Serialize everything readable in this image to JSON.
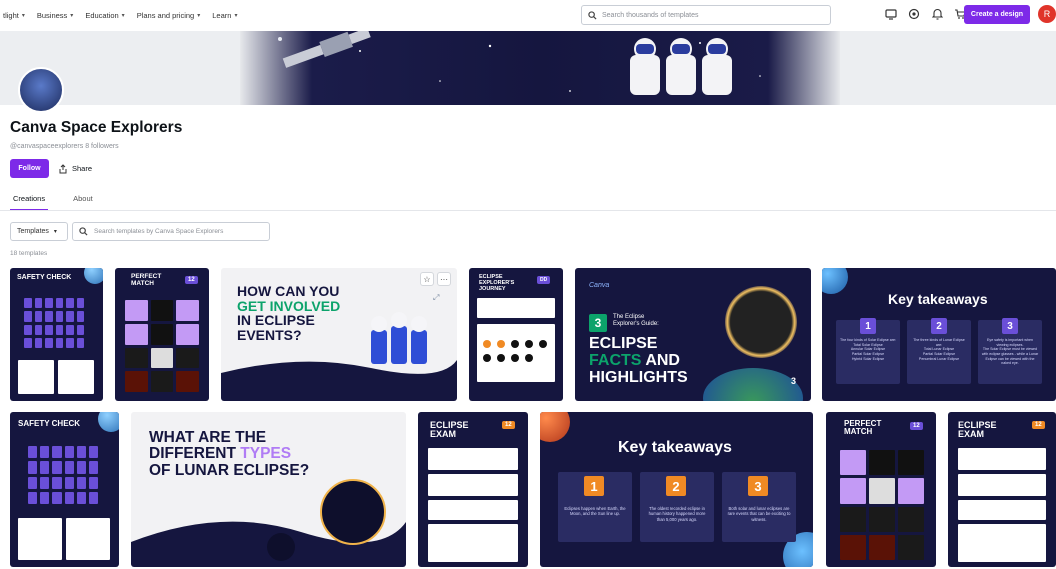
{
  "nav": {
    "items": [
      {
        "label": "tlight"
      },
      {
        "label": "Business"
      },
      {
        "label": "Education"
      },
      {
        "label": "Plans and pricing"
      },
      {
        "label": "Learn"
      }
    ],
    "search_placeholder": "Search thousands of templates",
    "create_label": "Create a design",
    "user_initial": "R",
    "icons": [
      "monitor-icon",
      "settings-icon",
      "bell-icon",
      "cart-icon"
    ]
  },
  "profile": {
    "name": "Canva Space Explorers",
    "handle": "@canvaspaceexplorers",
    "followers": "8 followers",
    "follow_label": "Follow",
    "share_label": "Share"
  },
  "tabs": [
    {
      "label": "Creations",
      "active": true
    },
    {
      "label": "About",
      "active": false
    }
  ],
  "filters": {
    "type_label": "Templates",
    "search_placeholder": "Search templates by Canva Space Explorers",
    "count": "18 templates"
  },
  "cards": {
    "c1": {
      "title": "SAFETY CHECK"
    },
    "c2": {
      "title_a": "PERFECT",
      "title_b": "MATCH",
      "badge": "12"
    },
    "c3": {
      "line1": "HOW CAN YOU",
      "line2": "GET INVOLVED",
      "line3": "IN ECLIPSE",
      "line4": "EVENTS?"
    },
    "c4": {
      "line1": "ECLIPSE",
      "line2": "EXPLORER'S",
      "line3": "JOURNEY",
      "badge": "DD"
    },
    "c5": {
      "brand": "Canva",
      "num": "3",
      "sub1": "The Eclipse",
      "sub2": "Explorer's Guide:",
      "line1": "ECLIPSE",
      "line2a": "FACTS",
      "line2b": "AND",
      "line3": "HIGHLIGHTS",
      "corner": "3"
    },
    "c6": {
      "title": "Key takeaways",
      "panels": [
        {
          "num": "1",
          "head": "The four kinds of Solar Eclipse are:",
          "items": [
            "Total Solar Eclipse",
            "Annular Solar Eclipse",
            "Partial Solar Eclipse",
            "Hybrid Solar Eclipse"
          ]
        },
        {
          "num": "2",
          "head": "The three kinds of Lunar Eclipse are:",
          "items": [
            "Total Lunar Eclipse",
            "Partial Solar Eclipse",
            "Penumbral Lunar Eclipse"
          ]
        },
        {
          "num": "3",
          "head": "Eye safety is important when viewing eclipses.",
          "items": [
            "The Solar Eclipse must be viewed with eclipse glasses - while a Lunar Eclipse can be viewed with the naked eye."
          ]
        }
      ]
    },
    "c7": {
      "title": "SAFETY CHECK"
    },
    "c8": {
      "line1": "WHAT ARE THE",
      "line2a": "DIFFERENT",
      "line2b": "TYPES",
      "line3": "OF LUNAR ECLIPSE?"
    },
    "c9": {
      "line1": "ECLIPSE",
      "line2": "EXAM",
      "badge": "12"
    },
    "c10": {
      "title": "Key takeaways",
      "panels": [
        {
          "num": "1",
          "text": "Eclipses happen when Earth, the Moon, and the Sun line up."
        },
        {
          "num": "2",
          "text": "The oldest recorded eclipse in human history happened more than 5,000 years ago."
        },
        {
          "num": "3",
          "text": "Both solar and lunar eclipses are rare events that can be exciting to witness."
        }
      ]
    },
    "c11": {
      "title_a": "PERFECT",
      "title_b": "MATCH",
      "badge": "12"
    },
    "c12": {
      "line1": "ECLIPSE",
      "line2": "EXAM",
      "badge": "12"
    }
  },
  "colors": {
    "brand_purple": "#7d2ae8",
    "navy": "#15163f",
    "accent_green": "#0ca36b",
    "accent_orange": "#f08a24",
    "accent_violet": "#b07cf5"
  }
}
